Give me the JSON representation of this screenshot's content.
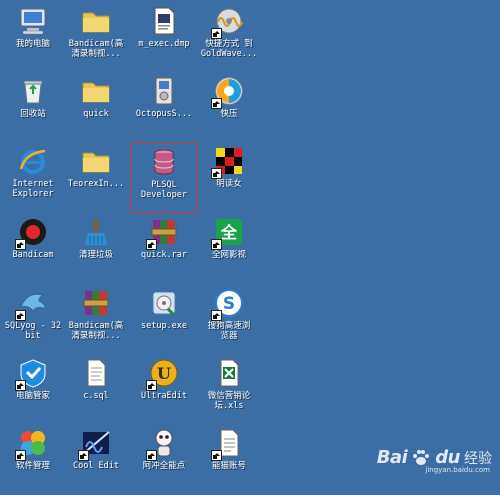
{
  "desktop": {
    "background_color": "#3a6ea5",
    "icons": [
      {
        "label": "我的电脑",
        "icon": "my-computer-icon"
      },
      {
        "label": "Bandicam(高\n清录制视...",
        "icon": "folder-icon"
      },
      {
        "label": "m_exec.dmp",
        "icon": "document-icon"
      },
      {
        "label": "快捷方式 到\nGoldWave...",
        "icon": "goldwave-icon"
      },
      {
        "label": "回收站",
        "icon": "recycle-bin-icon"
      },
      {
        "label": "quick",
        "icon": "folder-icon"
      },
      {
        "label": "OctopusS...",
        "icon": "installer-icon"
      },
      {
        "label": "快压",
        "icon": "kuaiya-icon"
      },
      {
        "label": "Internet\nExplorer",
        "icon": "internet-explorer-icon"
      },
      {
        "label": "TeorexIn...",
        "icon": "folder-icon"
      },
      {
        "label": "PLSQL\nDeveloper",
        "icon": "plsql-developer-icon",
        "selected": true
      },
      {
        "label": "明读女",
        "icon": "checkered-app-icon"
      },
      {
        "label": "Bandicam",
        "icon": "bandicam-icon"
      },
      {
        "label": "清理垃圾",
        "icon": "cleanup-icon"
      },
      {
        "label": "quick.rar",
        "icon": "rar-archive-icon"
      },
      {
        "label": "全网影视",
        "icon": "video-app-icon"
      },
      {
        "label": "SQLyog - 32\nbit",
        "icon": "sqlyog-icon"
      },
      {
        "label": "Bandicam(高\n清录制视...",
        "icon": "rar-archive-icon"
      },
      {
        "label": "setup.exe",
        "icon": "setup-icon"
      },
      {
        "label": "搜狗高速浏\n览器",
        "icon": "sogou-browser-icon"
      },
      {
        "label": "电脑管家",
        "icon": "pc-manager-icon"
      },
      {
        "label": "c.sql",
        "icon": "sql-file-icon"
      },
      {
        "label": "UltraEdit",
        "icon": "ultraedit-icon"
      },
      {
        "label": "微信营销论\n坛.xls",
        "icon": "excel-file-icon"
      },
      {
        "label": "软件管理",
        "icon": "software-manager-icon"
      },
      {
        "label": "Cool Edit",
        "icon": "cool-edit-icon"
      },
      {
        "label": "阿冲全能点",
        "icon": "robot-app-icon"
      },
      {
        "label": "能猫账号",
        "icon": "text-file-icon"
      }
    ]
  },
  "watermark": {
    "brand": "Bai",
    "brand_tail": "du",
    "suffix": "经验",
    "domain": "jingyan.baidu.com"
  }
}
